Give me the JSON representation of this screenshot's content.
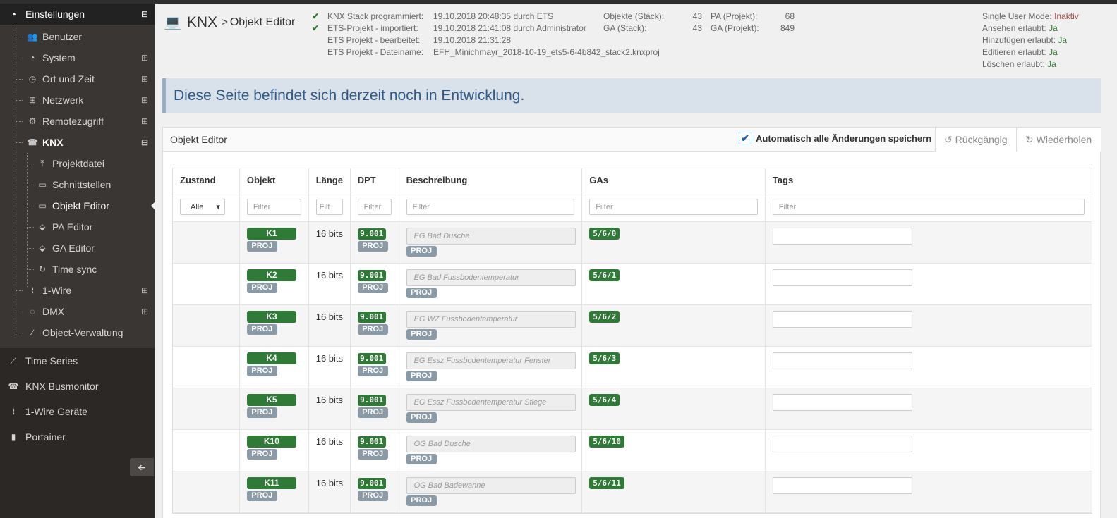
{
  "sidebar": {
    "header": {
      "label": "Einstellungen",
      "toggle": "⊟"
    },
    "items": [
      {
        "name": "benutzer",
        "label": "Benutzer",
        "icon": "users-icon",
        "glyph": "👥",
        "toggle": ""
      },
      {
        "name": "system",
        "label": "System",
        "icon": "dashboard-icon",
        "glyph": "◔",
        "toggle": "⊞"
      },
      {
        "name": "ort-und-zeit",
        "label": "Ort und Zeit",
        "icon": "clock-icon",
        "glyph": "◷",
        "toggle": "⊞"
      },
      {
        "name": "netzwerk",
        "label": "Netzwerk",
        "icon": "sitemap-icon",
        "glyph": "⊞",
        "toggle": "⊞"
      },
      {
        "name": "remotezugriff",
        "label": "Remotezugriff",
        "icon": "cogs-icon",
        "glyph": "⚙",
        "toggle": "⊞"
      },
      {
        "name": "knx",
        "label": "KNX",
        "icon": "knx-icon",
        "glyph": "☎",
        "toggle": "⊟"
      }
    ],
    "knx_items": [
      {
        "name": "projektdatei",
        "label": "Projektdatei",
        "icon": "upload-icon",
        "glyph": "⤒"
      },
      {
        "name": "schnittstellen",
        "label": "Schnittstellen",
        "icon": "laptop-icon",
        "glyph": "▭"
      },
      {
        "name": "objekt-editor",
        "label": "Objekt Editor",
        "icon": "laptop-icon",
        "glyph": "▭"
      },
      {
        "name": "pa-editor",
        "label": "PA Editor",
        "icon": "tags-icon",
        "glyph": "⬙"
      },
      {
        "name": "ga-editor",
        "label": "GA Editor",
        "icon": "tags-icon",
        "glyph": "⬙"
      },
      {
        "name": "time-sync",
        "label": "Time sync",
        "icon": "refresh-icon",
        "glyph": "↻"
      }
    ],
    "items2": [
      {
        "name": "1-wire",
        "label": "1-Wire",
        "icon": "wave-icon",
        "glyph": "⌇",
        "toggle": "⊞"
      },
      {
        "name": "dmx",
        "label": "DMX",
        "icon": "bulb-icon",
        "glyph": "◌",
        "toggle": "⊞"
      },
      {
        "name": "object-verwaltung",
        "label": "Object-Verwaltung",
        "icon": "magic-icon",
        "glyph": "⁄",
        "toggle": ""
      }
    ],
    "main_items": [
      {
        "name": "time-series",
        "label": "Time Series",
        "icon": "line-chart-icon",
        "glyph": "⟋"
      },
      {
        "name": "knx-busmonitor",
        "label": "KNX Busmonitor",
        "icon": "knx-icon",
        "glyph": "☎"
      },
      {
        "name": "1-wire-geraete",
        "label": "1-Wire Geräte",
        "icon": "wave-icon",
        "glyph": "⌇"
      },
      {
        "name": "portainer",
        "label": "Portainer",
        "icon": "portainer-icon",
        "glyph": "▮"
      }
    ],
    "collapse_glyph": "➔"
  },
  "header": {
    "knx": "KNX",
    "sep": ">",
    "page": "Objekt Editor"
  },
  "info": {
    "rows": [
      {
        "check": "✔",
        "label": "KNX Stack programmiert:",
        "value": "19.10.2018 20:48:35 durch ETS"
      },
      {
        "check": "✔",
        "label": "ETS-Projekt - importiert:",
        "value": "19.10.2018 21:41:08 durch Administrator"
      },
      {
        "check": "",
        "label": "ETS Projekt - bearbeitet:",
        "value": "19.10.2018 21:31:28"
      },
      {
        "check": "",
        "label": "ETS Projekt - Dateiname:",
        "value": "EFH_Minichmayr_2018-10-19_ets5-6-4b842_stack2.knxproj"
      }
    ],
    "stack": [
      {
        "label": "Objekte (Stack):",
        "value": "43"
      },
      {
        "label": "GA (Stack):",
        "value": "43"
      }
    ],
    "projekt": [
      {
        "label": "PA (Projekt):",
        "value": "68"
      },
      {
        "label": "GA (Projekt):",
        "value": "849"
      }
    ]
  },
  "perm": {
    "single_user_label": "Single User Mode:",
    "single_user_value": "Inaktiv",
    "ansehen_label": "Ansehen erlaubt:",
    "ansehen_value": "Ja",
    "hinzufuegen_label": "Hinzufügen erlaubt:",
    "hinzufuegen_value": "Ja",
    "editieren_label": "Editieren erlaubt:",
    "editieren_value": "Ja",
    "loeschen_label": "Löschen erlaubt:",
    "loeschen_value": "Ja"
  },
  "alert": "Diese Seite befindet sich derzeit noch in Entwicklung.",
  "panel": {
    "title": "Objekt Editor",
    "autosave_check": "✔",
    "autosave": "Automatisch alle Änderungen speichern",
    "undo": "↺ Rückgängig",
    "redo": "↻ Wiederholen"
  },
  "table": {
    "headers": [
      "Zustand",
      "Objekt",
      "Länge",
      "DPT",
      "Beschreibung",
      "GAs",
      "Tags"
    ],
    "filter_select": "Alle",
    "filter_caret": "▾",
    "filter_placeholder": "Filter",
    "filter_short": "Filt",
    "proj": "PROJ",
    "rows": [
      {
        "obj": "K1",
        "len": "16 bits",
        "dpt": "9.001",
        "desc": "EG Bad Dusche",
        "ga": "5/6/0"
      },
      {
        "obj": "K2",
        "len": "16 bits",
        "dpt": "9.001",
        "desc": "EG Bad Fussbodentemperatur",
        "ga": "5/6/1"
      },
      {
        "obj": "K3",
        "len": "16 bits",
        "dpt": "9.001",
        "desc": "EG WZ Fussbodentemperatur",
        "ga": "5/6/2"
      },
      {
        "obj": "K4",
        "len": "16 bits",
        "dpt": "9.001",
        "desc": "EG Essz Fussbodentemperatur Fenster",
        "ga": "5/6/3"
      },
      {
        "obj": "K5",
        "len": "16 bits",
        "dpt": "9.001",
        "desc": "EG Essz Fussbodentemperatur Stiege",
        "ga": "5/6/4"
      },
      {
        "obj": "K10",
        "len": "16 bits",
        "dpt": "9.001",
        "desc": "OG Bad Dusche",
        "ga": "5/6/10"
      },
      {
        "obj": "K11",
        "len": "16 bits",
        "dpt": "9.001",
        "desc": "OG Bad Badewanne",
        "ga": "5/6/11"
      }
    ]
  }
}
